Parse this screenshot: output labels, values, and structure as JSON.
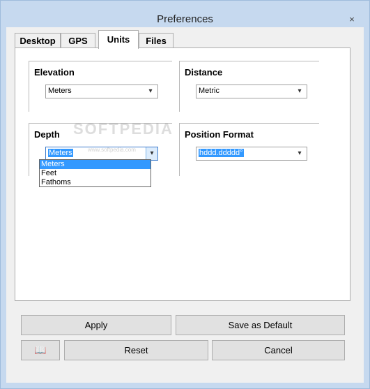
{
  "window": {
    "title": "Preferences",
    "close_glyph": "×"
  },
  "tabs": [
    {
      "label": "Desktop",
      "active": false
    },
    {
      "label": "GPS",
      "active": false
    },
    {
      "label": "Units",
      "active": true
    },
    {
      "label": "Files",
      "active": false
    }
  ],
  "groups": {
    "elevation": {
      "title": "Elevation",
      "value": "Meters"
    },
    "distance": {
      "title": "Distance",
      "value": "Metric"
    },
    "depth": {
      "title": "Depth",
      "value": "Meters",
      "options": [
        "Meters",
        "Feet",
        "Fathoms"
      ],
      "highlighted": "Meters"
    },
    "position_format": {
      "title": "Position Format",
      "value": "hddd.ddddd°"
    }
  },
  "watermark": {
    "text": "SOFTPEDIA",
    "sub": "www.softpedia.com"
  },
  "buttons": {
    "apply": "Apply",
    "save_default": "Save as Default",
    "help_icon": "book-icon",
    "reset": "Reset",
    "cancel": "Cancel"
  },
  "colors": {
    "title_bar": "#c6d9ef",
    "selection": "#3399ff"
  }
}
